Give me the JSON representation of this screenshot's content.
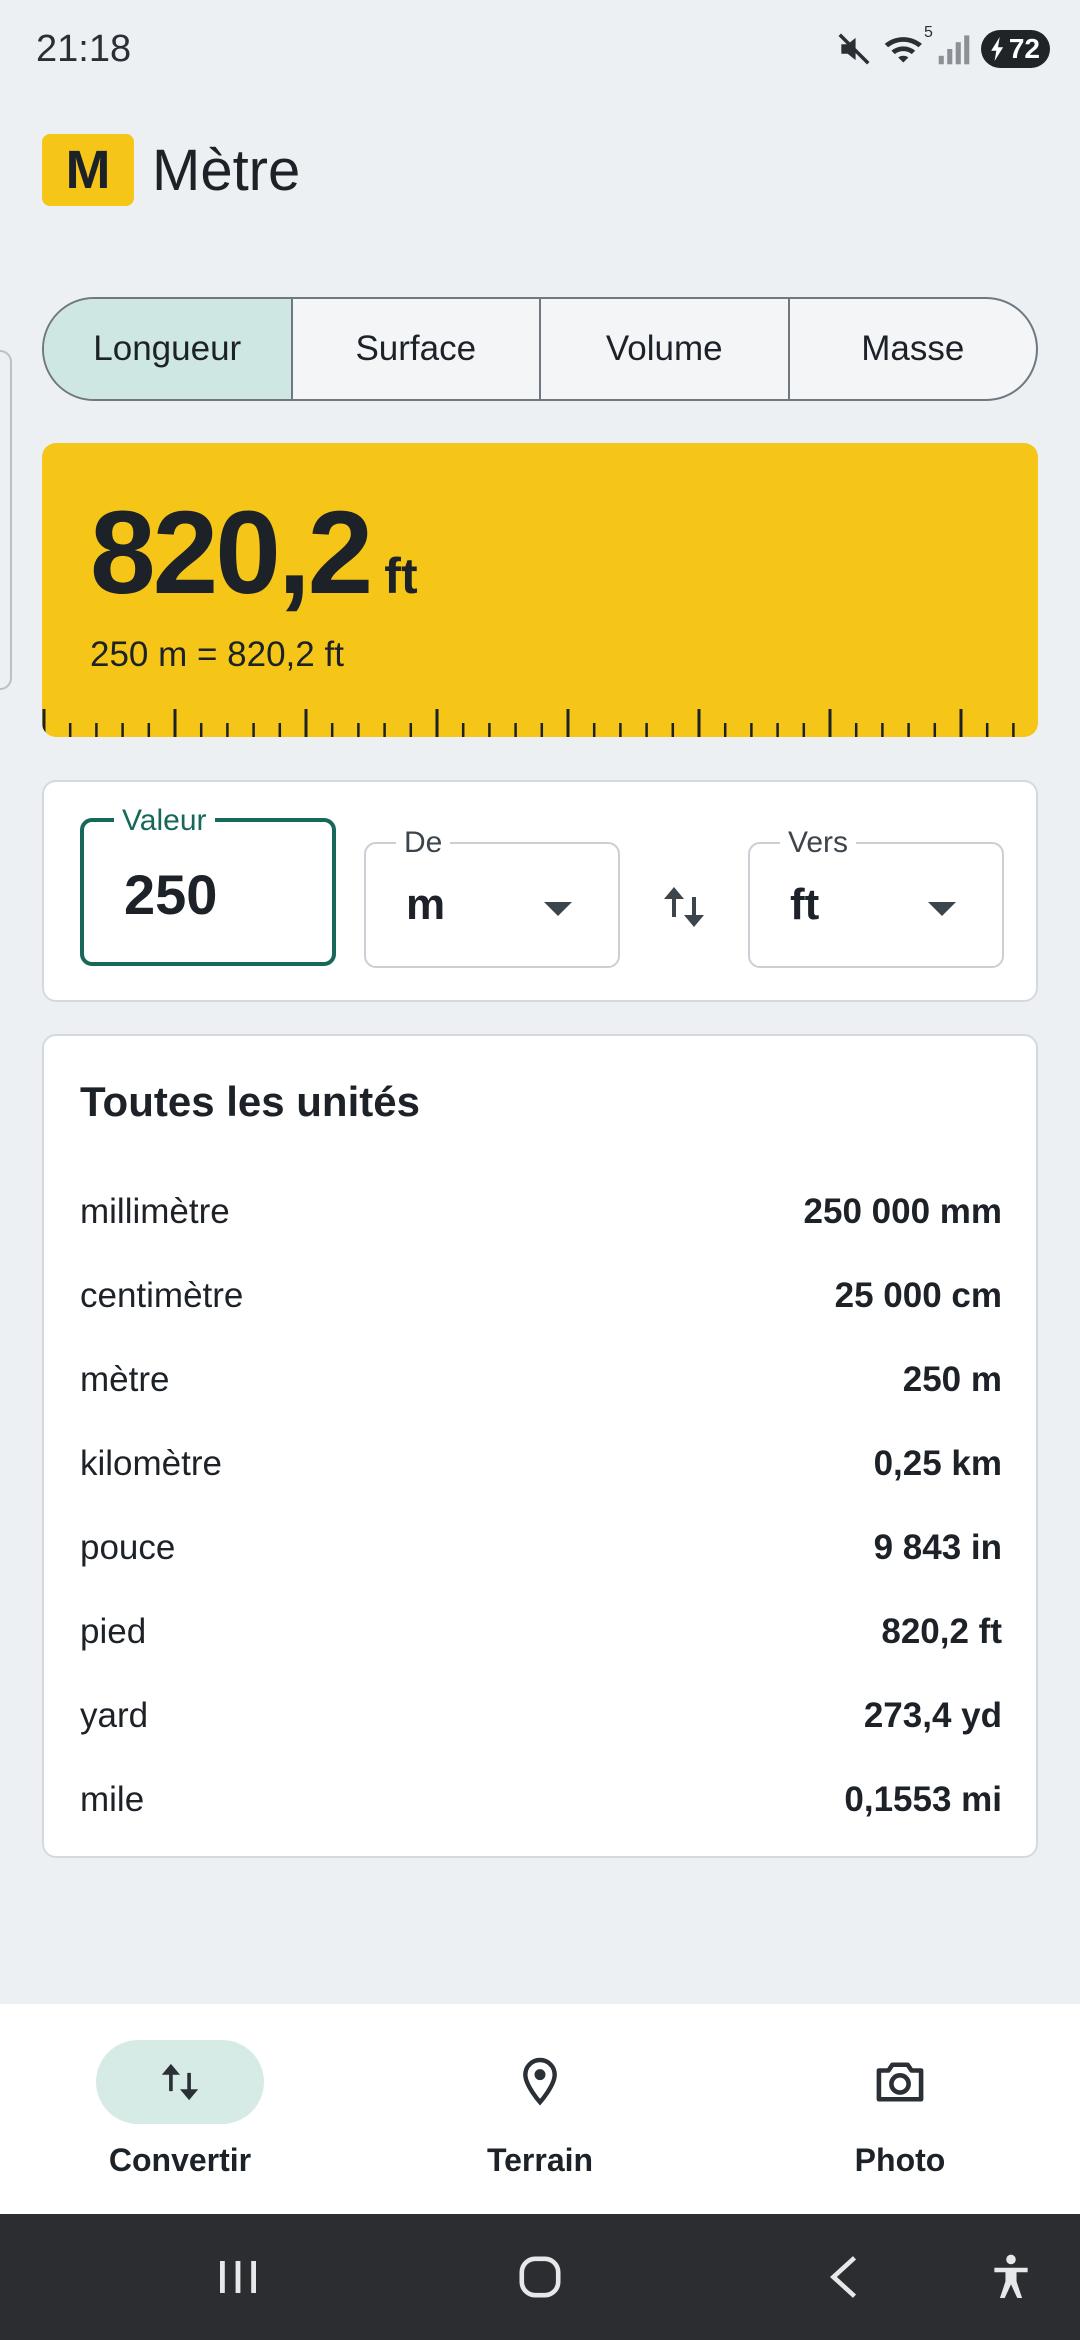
{
  "status_bar": {
    "time": "21:18",
    "wifi_badge": "5",
    "battery": "72",
    "icons": [
      "mute-icon",
      "wifi-icon",
      "signal-icon",
      "battery-charging-icon"
    ]
  },
  "app": {
    "logo_letter": "M",
    "title": "Mètre"
  },
  "tabs": [
    {
      "label": "Longueur",
      "active": true
    },
    {
      "label": "Surface",
      "active": false
    },
    {
      "label": "Volume",
      "active": false
    },
    {
      "label": "Masse",
      "active": false
    }
  ],
  "result": {
    "value": "820,2",
    "unit": "ft",
    "equation": "250 m = 820,2 ft"
  },
  "inputs": {
    "value_label": "Valeur",
    "value": "250",
    "from_label": "De",
    "from_unit": "m",
    "to_label": "Vers",
    "to_unit": "ft"
  },
  "all_units": {
    "title": "Toutes les unités",
    "rows": [
      {
        "name": "millimètre",
        "value": "250 000 mm"
      },
      {
        "name": "centimètre",
        "value": "25 000 cm"
      },
      {
        "name": "mètre",
        "value": "250 m"
      },
      {
        "name": "kilomètre",
        "value": "0,25 km"
      },
      {
        "name": "pouce",
        "value": "9 843 in"
      },
      {
        "name": "pied",
        "value": "820,2 ft"
      },
      {
        "name": "yard",
        "value": "273,4 yd"
      },
      {
        "name": "mile",
        "value": "0,1553 mi"
      }
    ]
  },
  "bottom_nav": [
    {
      "label": "Convertir",
      "icon": "swap-vertical-icon",
      "active": true
    },
    {
      "label": "Terrain",
      "icon": "location-pin-icon",
      "active": false
    },
    {
      "label": "Photo",
      "icon": "camera-icon",
      "active": false
    }
  ],
  "colors": {
    "accent_yellow": "#f5c518",
    "accent_green": "#17685a",
    "active_tab": "#cfe7e2"
  }
}
